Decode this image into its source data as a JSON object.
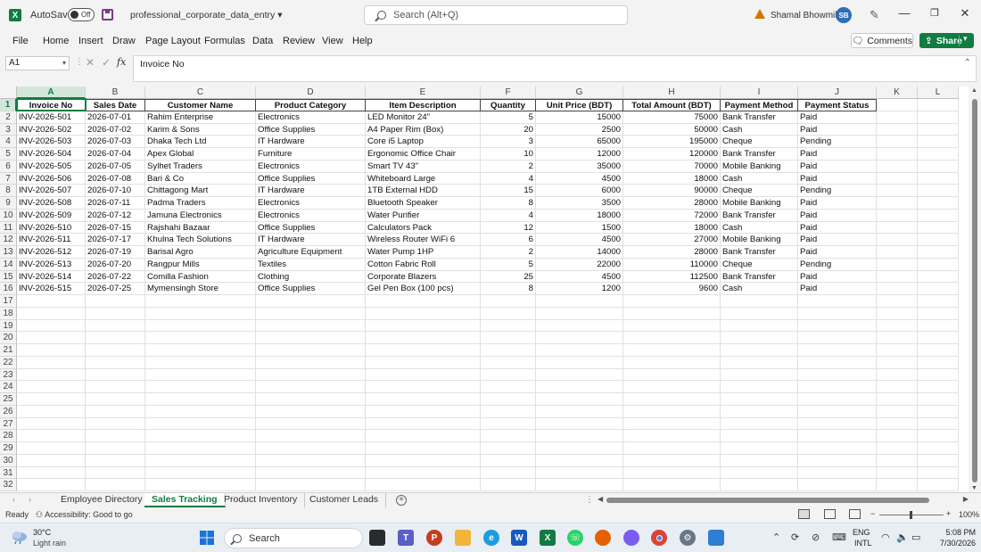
{
  "titlebar": {
    "autosave_label": "AutoSave",
    "autosave_state": "Off",
    "filename": "professional_corporate_data_entry",
    "search_placeholder": "Search (Alt+Q)",
    "user_name": "Shamal Bhowmik",
    "user_initials": "SB"
  },
  "ribbon": {
    "tabs": [
      "File",
      "Home",
      "Insert",
      "Draw",
      "Page Layout",
      "Formulas",
      "Data",
      "Review",
      "View",
      "Help"
    ],
    "comments_label": "Comments",
    "share_label": "Share"
  },
  "formula_bar": {
    "name_box": "A1",
    "fx_label": "fx",
    "content": "Invoice No"
  },
  "grid": {
    "columns": [
      "A",
      "B",
      "C",
      "D",
      "E",
      "F",
      "G",
      "H",
      "I",
      "J",
      "K",
      "L"
    ],
    "row_numbers": [
      "1",
      "2",
      "3",
      "4",
      "5",
      "6",
      "7",
      "8",
      "9",
      "10",
      "11",
      "12",
      "13",
      "14",
      "15",
      "16",
      "17",
      "18",
      "19",
      "20",
      "21",
      "22",
      "23",
      "24",
      "25",
      "26",
      "27",
      "28",
      "29",
      "30",
      "31",
      "32"
    ],
    "headers": [
      "Invoice No",
      "Sales Date",
      "Customer Name",
      "Product Category",
      "Item Description",
      "Quantity",
      "Unit Price (BDT)",
      "Total Amount (BDT)",
      "Payment Method",
      "Payment Status"
    ],
    "rows": [
      [
        "INV-2026-501",
        "2026-07-01",
        "Rahim Enterprise",
        "Electronics",
        "LED Monitor 24\"",
        "5",
        "15000",
        "75000",
        "Bank Transfer",
        "Paid"
      ],
      [
        "INV-2026-502",
        "2026-07-02",
        "Karim & Sons",
        "Office Supplies",
        "A4 Paper Rim (Box)",
        "20",
        "2500",
        "50000",
        "Cash",
        "Paid"
      ],
      [
        "INV-2026-503",
        "2026-07-03",
        "Dhaka Tech Ltd",
        "IT Hardware",
        "Core i5 Laptop",
        "3",
        "65000",
        "195000",
        "Cheque",
        "Pending"
      ],
      [
        "INV-2026-504",
        "2026-07-04",
        "Apex Global",
        "Furniture",
        "Ergonomic Office Chair",
        "10",
        "12000",
        "120000",
        "Bank Transfer",
        "Paid"
      ],
      [
        "INV-2026-505",
        "2026-07-05",
        "Sylhet Traders",
        "Electronics",
        "Smart TV 43\"",
        "2",
        "35000",
        "70000",
        "Mobile Banking",
        "Paid"
      ],
      [
        "INV-2026-506",
        "2026-07-08",
        "Bari & Co",
        "Office Supplies",
        "Whiteboard Large",
        "4",
        "4500",
        "18000",
        "Cash",
        "Paid"
      ],
      [
        "INV-2026-507",
        "2026-07-10",
        "Chittagong Mart",
        "IT Hardware",
        "1TB External HDD",
        "15",
        "6000",
        "90000",
        "Cheque",
        "Pending"
      ],
      [
        "INV-2026-508",
        "2026-07-11",
        "Padma Traders",
        "Electronics",
        "Bluetooth Speaker",
        "8",
        "3500",
        "28000",
        "Mobile Banking",
        "Paid"
      ],
      [
        "INV-2026-509",
        "2026-07-12",
        "Jamuna Electronics",
        "Electronics",
        "Water Purifier",
        "4",
        "18000",
        "72000",
        "Bank Transfer",
        "Paid"
      ],
      [
        "INV-2026-510",
        "2026-07-15",
        "Rajshahi Bazaar",
        "Office Supplies",
        "Calculators Pack",
        "12",
        "1500",
        "18000",
        "Cash",
        "Paid"
      ],
      [
        "INV-2026-511",
        "2026-07-17",
        "Khulna Tech Solutions",
        "IT Hardware",
        "Wireless Router WiFi 6",
        "6",
        "4500",
        "27000",
        "Mobile Banking",
        "Paid"
      ],
      [
        "INV-2026-512",
        "2026-07-19",
        "Barisal Agro",
        "Agriculture Equipment",
        "Water Pump 1HP",
        "2",
        "14000",
        "28000",
        "Bank Transfer",
        "Paid"
      ],
      [
        "INV-2026-513",
        "2026-07-20",
        "Rangpur Mills",
        "Textiles",
        "Cotton Fabric Roll",
        "5",
        "22000",
        "110000",
        "Cheque",
        "Pending"
      ],
      [
        "INV-2026-514",
        "2026-07-22",
        "Comilla Fashion",
        "Clothing",
        "Corporate Blazers",
        "25",
        "4500",
        "112500",
        "Bank Transfer",
        "Paid"
      ],
      [
        "INV-2026-515",
        "2026-07-25",
        "Mymensingh Store",
        "Office Supplies",
        "Gel Pen Box (100 pcs)",
        "8",
        "1200",
        "9600",
        "Cash",
        "Paid"
      ]
    ]
  },
  "sheet_tabs": [
    "Employee Directory",
    "Sales Tracking",
    "Product Inventory",
    "Customer Leads"
  ],
  "active_sheet": "Sales Tracking",
  "status_bar": {
    "ready": "Ready",
    "accessibility": "Accessibility: Good to go",
    "zoom": "100%"
  },
  "taskbar": {
    "temperature": "30°C",
    "weather": "Light rain",
    "search_label": "Search",
    "language": "ENG",
    "layout": "INTL",
    "time": "5:08 PM",
    "date": "7/30/2026"
  },
  "colors": {
    "excel_green": "#107c41",
    "avatar_blue": "#2f6fb8"
  }
}
